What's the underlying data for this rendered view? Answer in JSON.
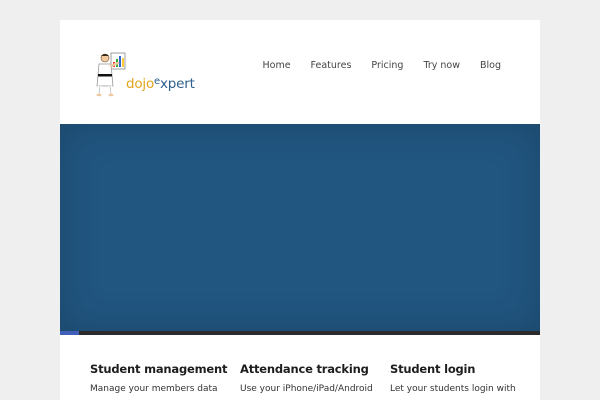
{
  "logo": {
    "part1": "dojo",
    "part2": "e",
    "part3": "xpert"
  },
  "nav": {
    "items": [
      "Home",
      "Features",
      "Pricing",
      "Try now",
      "Blog"
    ]
  },
  "hero": {
    "background_color": "#215681"
  },
  "slider": {
    "progress_fraction": 0.04,
    "accent_color": "#3f5fb8"
  },
  "features": [
    {
      "title": "Student management",
      "desc": "Manage your members data"
    },
    {
      "title": "Attendance tracking",
      "desc": "Use your iPhone/iPad/Android"
    },
    {
      "title": "Student login",
      "desc": "Let your students login with"
    }
  ]
}
